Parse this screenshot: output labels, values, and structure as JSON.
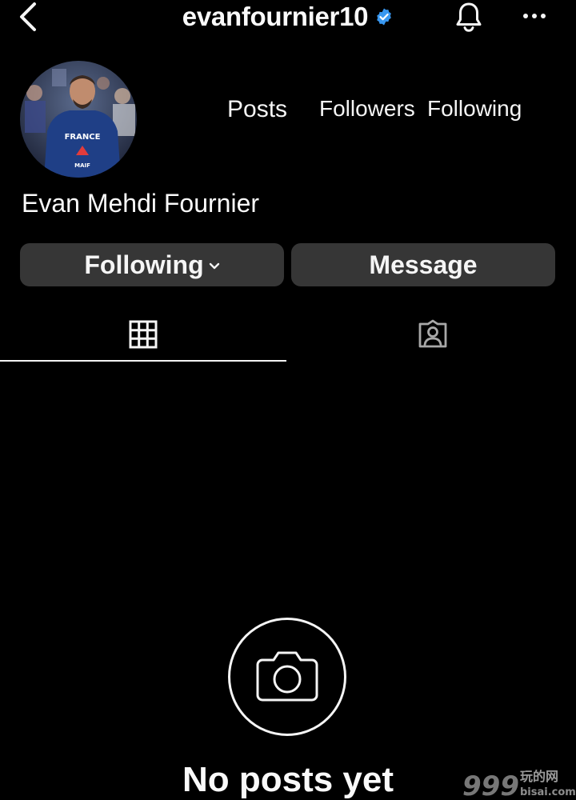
{
  "header": {
    "username": "evanfournier10",
    "verified": true,
    "icons": {
      "back": "chevron-left-icon",
      "verified": "verified-badge-icon",
      "notifications": "bell-icon",
      "more": "more-horizontal-icon"
    }
  },
  "profile": {
    "avatar_alt": "profile-photo",
    "full_name": "Evan Mehdi Fournier",
    "stats": {
      "posts_label": "Posts",
      "followers_label": "Followers",
      "following_label": "Following"
    }
  },
  "actions": {
    "following_label": "Following",
    "message_label": "Message"
  },
  "tabs": [
    {
      "name": "grid",
      "icon": "grid-icon",
      "active": true
    },
    {
      "name": "tagged",
      "icon": "tagged-person-icon",
      "active": false
    }
  ],
  "empty_state": {
    "icon": "camera-icon",
    "title": "No posts yet"
  },
  "watermark": {
    "logo_text": "999",
    "cn_text": "玩的网",
    "domain": "bisai.com"
  },
  "colors": {
    "background": "#000000",
    "text": "#f5f5f5",
    "button_bg": "#363636",
    "verified_blue": "#3897f0"
  }
}
